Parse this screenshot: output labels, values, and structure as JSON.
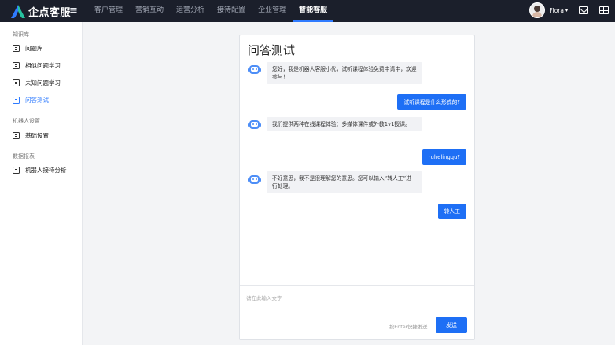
{
  "app": {
    "brand": "企点客服",
    "menu_icon": "hamburger-menu-icon"
  },
  "nav": {
    "items": [
      {
        "label": "客户管理"
      },
      {
        "label": "营销互动"
      },
      {
        "label": "运营分析"
      },
      {
        "label": "接待配置"
      },
      {
        "label": "企业管理"
      },
      {
        "label": "智能客服",
        "active": true
      }
    ]
  },
  "user": {
    "name": "Flora",
    "caret": "▾"
  },
  "sidebar": {
    "groups": [
      {
        "title": "知识库",
        "items": [
          {
            "label": "问题库",
            "icon": "question-bank-icon"
          },
          {
            "label": "相似问题学习",
            "icon": "similar-learning-icon"
          },
          {
            "label": "未知问题学习",
            "icon": "unknown-learning-icon"
          },
          {
            "label": "问答测试",
            "icon": "qa-test-icon",
            "active": true
          }
        ]
      },
      {
        "title": "机器人设置",
        "items": [
          {
            "label": "基础设置",
            "icon": "robot-settings-icon"
          }
        ]
      },
      {
        "title": "数据报表",
        "items": [
          {
            "label": "机器人接待分析",
            "icon": "robot-analytics-icon"
          }
        ]
      }
    ]
  },
  "chat": {
    "title": "问答测试",
    "messages": [
      {
        "from": "bot",
        "text_lines": [
          "您好，我是机器人客服小优，试听课程体验免费申请中，欢迎",
          "参与！"
        ]
      },
      {
        "from": "user",
        "text": "试听课程是什么形式的?"
      },
      {
        "from": "bot",
        "text_lines": [
          "我们提供两种在线课程体验：多媒体课件或外教1v1授课。"
        ]
      },
      {
        "from": "user",
        "text": "ruhelingqu?"
      },
      {
        "from": "bot",
        "text_lines": [
          "不好意思，我不是很理解您的意思。您可以输入“转人工”进",
          "行处理。"
        ]
      },
      {
        "from": "user",
        "text": "转人工"
      }
    ],
    "input_placeholder": "请在此输入文字",
    "input_value": "",
    "send_hint": "按Enter快捷发送",
    "send_label": "发送"
  },
  "colors": {
    "accent": "#1e6ff5",
    "topbar": "#1b1f2b"
  }
}
